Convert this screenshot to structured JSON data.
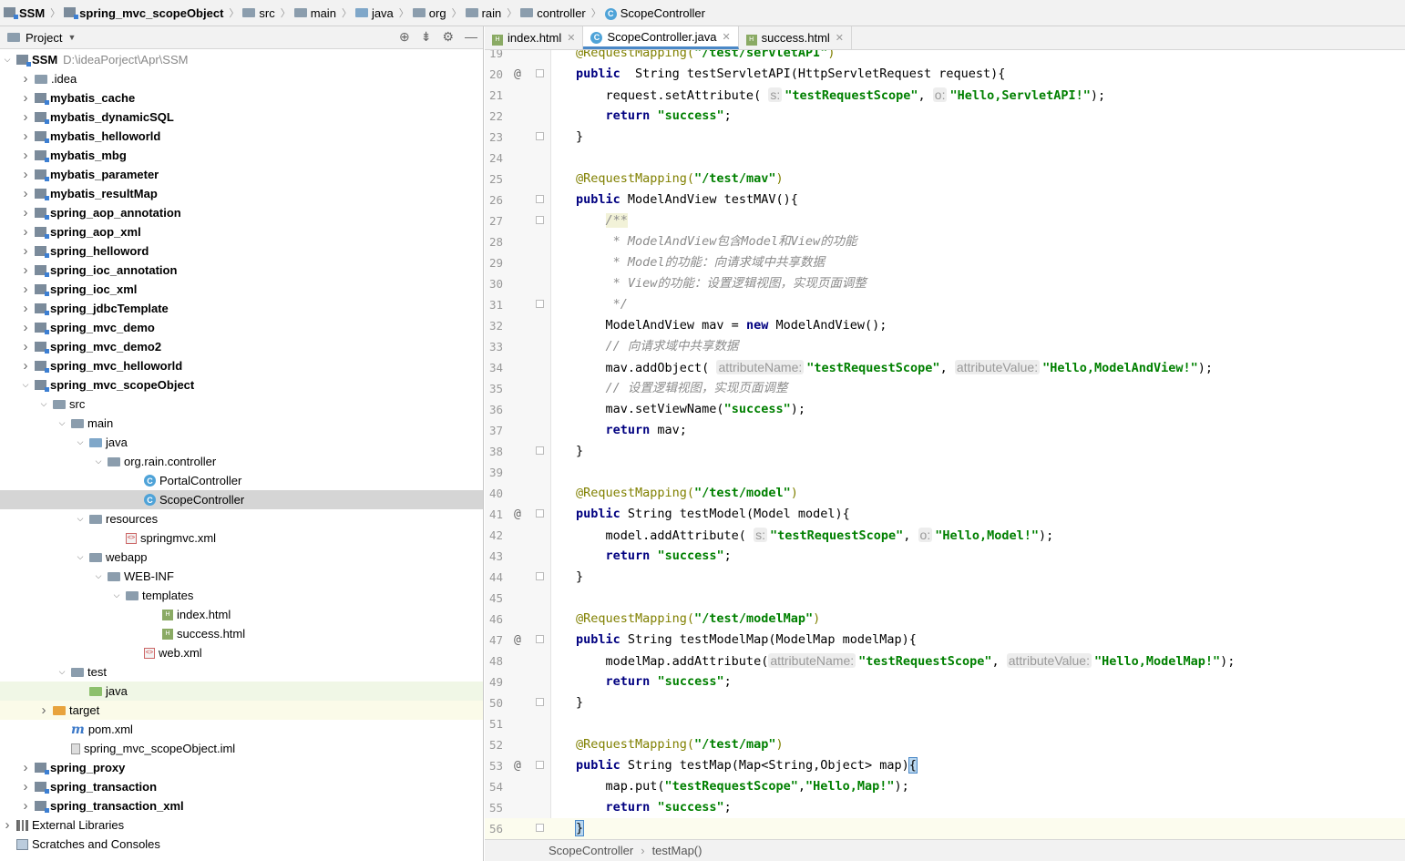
{
  "breadcrumb": [
    {
      "label": "SSM",
      "icon": "module-icon"
    },
    {
      "label": "spring_mvc_scopeObject",
      "icon": "module-icon"
    },
    {
      "label": "src",
      "icon": "folder-icon"
    },
    {
      "label": "main",
      "icon": "folder-icon"
    },
    {
      "label": "java",
      "icon": "source-folder-icon"
    },
    {
      "label": "org",
      "icon": "package-icon"
    },
    {
      "label": "rain",
      "icon": "package-icon"
    },
    {
      "label": "controller",
      "icon": "package-icon"
    },
    {
      "label": "ScopeController",
      "icon": "class-icon"
    }
  ],
  "project_panel": {
    "title": "Project",
    "tree": [
      {
        "label": "SSM",
        "path": "D:\\ideaPorject\\Apr\\SSM",
        "depth": 0,
        "arrow": "open",
        "icon": "module",
        "bold": true
      },
      {
        "label": ".idea",
        "depth": 1,
        "arrow": "closed",
        "icon": "folder"
      },
      {
        "label": "mybatis_cache",
        "depth": 1,
        "arrow": "closed",
        "icon": "module",
        "bold": true
      },
      {
        "label": "mybatis_dynamicSQL",
        "depth": 1,
        "arrow": "closed",
        "icon": "module",
        "bold": true
      },
      {
        "label": "mybatis_helloworld",
        "depth": 1,
        "arrow": "closed",
        "icon": "module",
        "bold": true
      },
      {
        "label": "mybatis_mbg",
        "depth": 1,
        "arrow": "closed",
        "icon": "module",
        "bold": true
      },
      {
        "label": "mybatis_parameter",
        "depth": 1,
        "arrow": "closed",
        "icon": "module",
        "bold": true
      },
      {
        "label": "mybatis_resultMap",
        "depth": 1,
        "arrow": "closed",
        "icon": "module",
        "bold": true
      },
      {
        "label": "spring_aop_annotation",
        "depth": 1,
        "arrow": "closed",
        "icon": "module",
        "bold": true
      },
      {
        "label": "spring_aop_xml",
        "depth": 1,
        "arrow": "closed",
        "icon": "module",
        "bold": true
      },
      {
        "label": "spring_helloword",
        "depth": 1,
        "arrow": "closed",
        "icon": "module",
        "bold": true
      },
      {
        "label": "spring_ioc_annotation",
        "depth": 1,
        "arrow": "closed",
        "icon": "module",
        "bold": true
      },
      {
        "label": "spring_ioc_xml",
        "depth": 1,
        "arrow": "closed",
        "icon": "module",
        "bold": true
      },
      {
        "label": "spring_jdbcTemplate",
        "depth": 1,
        "arrow": "closed",
        "icon": "module",
        "bold": true
      },
      {
        "label": "spring_mvc_demo",
        "depth": 1,
        "arrow": "closed",
        "icon": "module",
        "bold": true
      },
      {
        "label": "spring_mvc_demo2",
        "depth": 1,
        "arrow": "closed",
        "icon": "module",
        "bold": true
      },
      {
        "label": "spring_mvc_helloworld",
        "depth": 1,
        "arrow": "closed",
        "icon": "module",
        "bold": true
      },
      {
        "label": "spring_mvc_scopeObject",
        "depth": 1,
        "arrow": "open",
        "icon": "module",
        "bold": true
      },
      {
        "label": "src",
        "depth": 2,
        "arrow": "open",
        "icon": "folder"
      },
      {
        "label": "main",
        "depth": 3,
        "arrow": "open",
        "icon": "folder"
      },
      {
        "label": "java",
        "depth": 4,
        "arrow": "open",
        "icon": "source-folder"
      },
      {
        "label": "org.rain.controller",
        "depth": 5,
        "arrow": "open",
        "icon": "folder"
      },
      {
        "label": "PortalController",
        "depth": 7,
        "arrow": "none",
        "icon": "class"
      },
      {
        "label": "ScopeController",
        "depth": 7,
        "arrow": "none",
        "icon": "class",
        "selected": true
      },
      {
        "label": "resources",
        "depth": 4,
        "arrow": "open",
        "icon": "folder"
      },
      {
        "label": "springmvc.xml",
        "depth": 6,
        "arrow": "none",
        "icon": "xml"
      },
      {
        "label": "webapp",
        "depth": 4,
        "arrow": "open",
        "icon": "folder"
      },
      {
        "label": "WEB-INF",
        "depth": 5,
        "arrow": "open",
        "icon": "folder"
      },
      {
        "label": "templates",
        "depth": 6,
        "arrow": "open",
        "icon": "folder"
      },
      {
        "label": "index.html",
        "depth": 8,
        "arrow": "none",
        "icon": "html"
      },
      {
        "label": "success.html",
        "depth": 8,
        "arrow": "none",
        "icon": "html"
      },
      {
        "label": "web.xml",
        "depth": 7,
        "arrow": "none",
        "icon": "xml"
      },
      {
        "label": "test",
        "depth": 3,
        "arrow": "open",
        "icon": "folder"
      },
      {
        "label": "java",
        "depth": 4,
        "arrow": "none",
        "icon": "test-folder",
        "tint": "green"
      },
      {
        "label": "target",
        "depth": 2,
        "arrow": "closed",
        "icon": "excluded-folder",
        "tint": "yellow"
      },
      {
        "label": "pom.xml",
        "depth": 3,
        "arrow": "none",
        "icon": "maven"
      },
      {
        "label": "spring_mvc_scopeObject.iml",
        "depth": 3,
        "arrow": "none",
        "icon": "iml"
      },
      {
        "label": "spring_proxy",
        "depth": 1,
        "arrow": "closed",
        "icon": "module",
        "bold": true
      },
      {
        "label": "spring_transaction",
        "depth": 1,
        "arrow": "closed",
        "icon": "module",
        "bold": true
      },
      {
        "label": "spring_transaction_xml",
        "depth": 1,
        "arrow": "closed",
        "icon": "module",
        "bold": true
      },
      {
        "label": "External Libraries",
        "depth": 0,
        "arrow": "closed",
        "icon": "library"
      },
      {
        "label": "Scratches and Consoles",
        "depth": 0,
        "arrow": "none",
        "icon": "scratch"
      }
    ]
  },
  "tabs": [
    {
      "label": "index.html",
      "icon": "html",
      "active": false
    },
    {
      "label": "ScopeController.java",
      "icon": "class",
      "active": true
    },
    {
      "label": "success.html",
      "icon": "html",
      "active": false
    }
  ],
  "editor": {
    "lines": [
      {
        "n": "19",
        "segs": [
          [
            "ann",
            "@RequestMapping("
          ],
          [
            "str",
            "\"/test/servletAPI\""
          ],
          [
            "ann",
            ")"
          ]
        ]
      },
      {
        "n": "20",
        "mark": "@",
        "fold": true,
        "segs": [
          [
            "kw",
            "public"
          ],
          [
            "",
            "  String testServletAPI(HttpServletRequest request){"
          ]
        ]
      },
      {
        "n": "21",
        "segs": [
          [
            "",
            "    request.setAttribute( "
          ],
          [
            "hint",
            "s:"
          ],
          [
            "str",
            "\"testRequestScope\""
          ],
          [
            "",
            ", "
          ],
          [
            "hint",
            "o:"
          ],
          [
            "str",
            "\"Hello,ServletAPI!\""
          ],
          [
            "",
            ");"
          ]
        ]
      },
      {
        "n": "22",
        "segs": [
          [
            "",
            "    "
          ],
          [
            "kw",
            "return"
          ],
          [
            "",
            " "
          ],
          [
            "str",
            "\"success\""
          ],
          [
            "",
            ";"
          ]
        ]
      },
      {
        "n": "23",
        "fold": true,
        "segs": [
          [
            "",
            "}"
          ]
        ]
      },
      {
        "n": "24",
        "segs": []
      },
      {
        "n": "25",
        "segs": [
          [
            "ann",
            "@RequestMapping("
          ],
          [
            "str",
            "\"/test/mav\""
          ],
          [
            "ann",
            ")"
          ]
        ]
      },
      {
        "n": "26",
        "fold": true,
        "segs": [
          [
            "kw",
            "public"
          ],
          [
            "",
            " ModelAndView testMAV(){"
          ]
        ]
      },
      {
        "n": "27",
        "fold": true,
        "segs": [
          [
            "",
            "    "
          ],
          [
            "cmtdoc",
            "/**"
          ]
        ]
      },
      {
        "n": "28",
        "segs": [
          [
            "cmt",
            "     * ModelAndView包含Model和View的功能"
          ]
        ]
      },
      {
        "n": "29",
        "segs": [
          [
            "cmt",
            "     * Model的功能：向请求域中共享数据"
          ]
        ]
      },
      {
        "n": "30",
        "segs": [
          [
            "cmt",
            "     * View的功能：设置逻辑视图，实现页面调整"
          ]
        ]
      },
      {
        "n": "31",
        "fold": true,
        "segs": [
          [
            "cmt",
            "     */"
          ]
        ]
      },
      {
        "n": "32",
        "segs": [
          [
            "",
            "    ModelAndView mav = "
          ],
          [
            "kw",
            "new"
          ],
          [
            "",
            " ModelAndView();"
          ]
        ]
      },
      {
        "n": "33",
        "segs": [
          [
            "cmt",
            "    // 向请求域中共享数据"
          ]
        ]
      },
      {
        "n": "34",
        "segs": [
          [
            "",
            "    mav.addObject( "
          ],
          [
            "hint",
            "attributeName:"
          ],
          [
            "str",
            "\"testRequestScope\""
          ],
          [
            "",
            ", "
          ],
          [
            "hint",
            "attributeValue:"
          ],
          [
            "str",
            "\"Hello,ModelAndView!\""
          ],
          [
            "",
            ");"
          ]
        ]
      },
      {
        "n": "35",
        "segs": [
          [
            "cmt",
            "    // 设置逻辑视图，实现页面调整"
          ]
        ]
      },
      {
        "n": "36",
        "segs": [
          [
            "",
            "    mav.setViewName("
          ],
          [
            "str",
            "\"success\""
          ],
          [
            "",
            ");"
          ]
        ]
      },
      {
        "n": "37",
        "segs": [
          [
            "",
            "    "
          ],
          [
            "kw",
            "return"
          ],
          [
            "",
            " mav;"
          ]
        ]
      },
      {
        "n": "38",
        "fold": true,
        "segs": [
          [
            "",
            "}"
          ]
        ]
      },
      {
        "n": "39",
        "segs": []
      },
      {
        "n": "40",
        "segs": [
          [
            "ann",
            "@RequestMapping("
          ],
          [
            "str",
            "\"/test/model\""
          ],
          [
            "ann",
            ")"
          ]
        ]
      },
      {
        "n": "41",
        "mark": "@",
        "fold": true,
        "segs": [
          [
            "kw",
            "public"
          ],
          [
            "",
            " String testModel(Model model){"
          ]
        ]
      },
      {
        "n": "42",
        "segs": [
          [
            "",
            "    model.addAttribute( "
          ],
          [
            "hint",
            "s:"
          ],
          [
            "str",
            "\"testRequestScope\""
          ],
          [
            "",
            ", "
          ],
          [
            "hint",
            "o:"
          ],
          [
            "str",
            "\"Hello,Model!\""
          ],
          [
            "",
            ");"
          ]
        ]
      },
      {
        "n": "43",
        "segs": [
          [
            "",
            "    "
          ],
          [
            "kw",
            "return"
          ],
          [
            "",
            " "
          ],
          [
            "str",
            "\"success\""
          ],
          [
            "",
            ";"
          ]
        ]
      },
      {
        "n": "44",
        "fold": true,
        "segs": [
          [
            "",
            "}"
          ]
        ]
      },
      {
        "n": "45",
        "segs": []
      },
      {
        "n": "46",
        "segs": [
          [
            "ann",
            "@RequestMapping("
          ],
          [
            "str",
            "\"/test/modelMap\""
          ],
          [
            "ann",
            ")"
          ]
        ]
      },
      {
        "n": "47",
        "mark": "@",
        "fold": true,
        "segs": [
          [
            "kw",
            "public"
          ],
          [
            "",
            " String testModelMap(ModelMap modelMap){"
          ]
        ]
      },
      {
        "n": "48",
        "segs": [
          [
            "",
            "    modelMap.addAttribute("
          ],
          [
            "hint",
            "attributeName:"
          ],
          [
            "str",
            "\"testRequestScope\""
          ],
          [
            "",
            ", "
          ],
          [
            "hint",
            "attributeValue:"
          ],
          [
            "str",
            "\"Hello,ModelMap!\""
          ],
          [
            "",
            ");"
          ]
        ]
      },
      {
        "n": "49",
        "segs": [
          [
            "",
            "    "
          ],
          [
            "kw",
            "return"
          ],
          [
            "",
            " "
          ],
          [
            "str",
            "\"success\""
          ],
          [
            "",
            ";"
          ]
        ]
      },
      {
        "n": "50",
        "fold": true,
        "segs": [
          [
            "",
            "}"
          ]
        ]
      },
      {
        "n": "51",
        "segs": []
      },
      {
        "n": "52",
        "segs": [
          [
            "ann",
            "@RequestMapping("
          ],
          [
            "str",
            "\"/test/map\""
          ],
          [
            "ann",
            ")"
          ]
        ]
      },
      {
        "n": "53",
        "mark": "@",
        "fold": true,
        "segs": [
          [
            "kw",
            "public"
          ],
          [
            "",
            " String testMap(Map<String,Object> map)"
          ],
          [
            "brace",
            "{"
          ]
        ]
      },
      {
        "n": "54",
        "segs": [
          [
            "",
            "    map.put("
          ],
          [
            "str",
            "\"testRequestScope\""
          ],
          [
            "",
            ","
          ],
          [
            "str",
            "\"Hello,Map!\""
          ],
          [
            "",
            ");"
          ]
        ]
      },
      {
        "n": "55",
        "segs": [
          [
            "",
            "    "
          ],
          [
            "kw",
            "return"
          ],
          [
            "",
            " "
          ],
          [
            "str",
            "\"success\""
          ],
          [
            "",
            ";"
          ]
        ]
      },
      {
        "n": "56",
        "fold": true,
        "current": true,
        "segs": [
          [
            "brace",
            "}"
          ]
        ]
      }
    ]
  },
  "status_breadcrumb": [
    "ScopeController",
    "testMap()"
  ]
}
